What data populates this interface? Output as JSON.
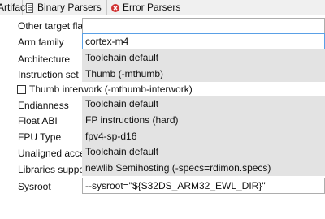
{
  "tabs": [
    {
      "label": "Artifact"
    },
    {
      "label": "Binary Parsers",
      "icon": "binary-parser-icon"
    },
    {
      "label": "Error Parsers",
      "icon": "error-parser-icon"
    }
  ],
  "form": {
    "other_target_flags": {
      "label": "Other target flags",
      "value": ""
    },
    "arm_family": {
      "label": "Arm family",
      "value": "cortex-m4"
    },
    "architecture": {
      "label": "Architecture",
      "value": "Toolchain default"
    },
    "instruction_set": {
      "label": "Instruction set",
      "value": "Thumb (-mthumb)"
    },
    "thumb_interwork": {
      "label": "Thumb interwork (-mthumb-interwork)",
      "checked": false
    },
    "endianness": {
      "label": "Endianness",
      "value": "Toolchain default"
    },
    "float_abi": {
      "label": "Float ABI",
      "value": "FP instructions (hard)"
    },
    "fpu_type": {
      "label": "FPU Type",
      "value": "fpv4-sp-d16"
    },
    "unaligned_access": {
      "label": "Unaligned access",
      "value": "Toolchain default"
    },
    "libraries_support": {
      "label": "Libraries support",
      "value": "newlib Semihosting (-specs=rdimon.specs)"
    },
    "sysroot": {
      "label": "Sysroot",
      "value": "--sysroot=\"${S32DS_ARM32_EWL_DIR}\""
    }
  }
}
